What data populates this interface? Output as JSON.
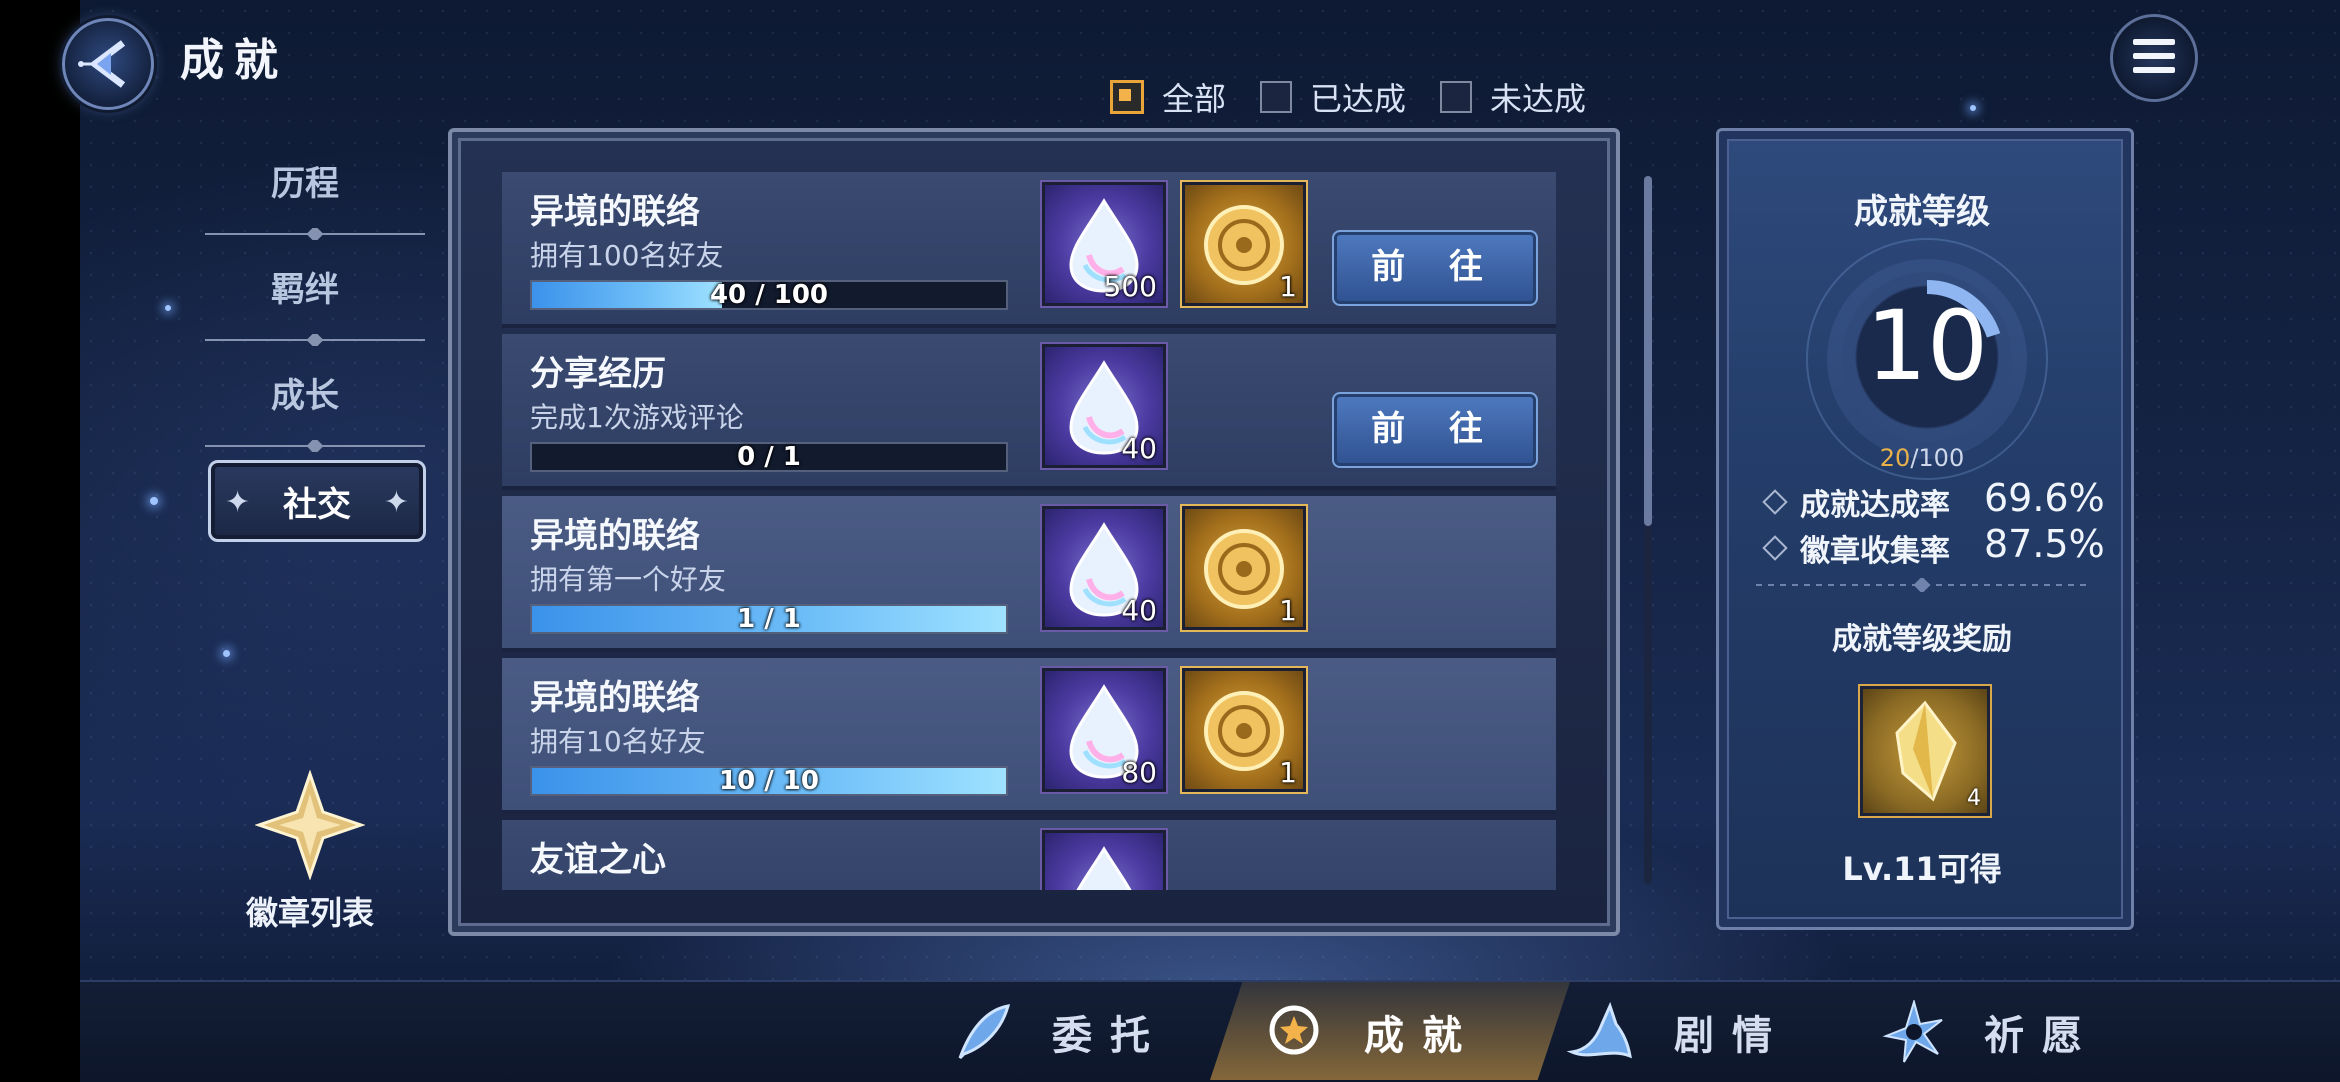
{
  "header": {
    "title": "成就"
  },
  "filters": [
    {
      "label": "全部",
      "checked": true
    },
    {
      "label": "已达成",
      "checked": false
    },
    {
      "label": "未达成",
      "checked": false
    }
  ],
  "sidebar": {
    "items": [
      {
        "label": "历程",
        "active": false
      },
      {
        "label": "羁绊",
        "active": false
      },
      {
        "label": "成长",
        "active": false
      },
      {
        "label": "社交",
        "active": true
      }
    ],
    "badge_list_label": "徽章列表"
  },
  "achievements": [
    {
      "title": "异境的联络",
      "desc": "拥有100名好友",
      "progress_text": "40 / 100",
      "progress": 0.4,
      "rewards": [
        {
          "type": "gem",
          "qty": "500"
        },
        {
          "type": "coin",
          "qty": "1"
        }
      ],
      "button": "前 往",
      "completed": false
    },
    {
      "title": "分享经历",
      "desc": "完成1次游戏评论",
      "progress_text": "0 / 1",
      "progress": 0,
      "rewards": [
        {
          "type": "gem",
          "qty": "40"
        }
      ],
      "button": "前 往",
      "completed": false
    },
    {
      "title": "异境的联络",
      "desc": "拥有第一个好友",
      "progress_text": "1 / 1",
      "progress": 1,
      "rewards": [
        {
          "type": "gem",
          "qty": "40"
        },
        {
          "type": "coin",
          "qty": "1"
        }
      ],
      "completed": true
    },
    {
      "title": "异境的联络",
      "desc": "拥有10名好友",
      "progress_text": "10 / 10",
      "progress": 1,
      "rewards": [
        {
          "type": "gem",
          "qty": "80"
        },
        {
          "type": "coin",
          "qty": "1"
        }
      ],
      "completed": true
    },
    {
      "title": "友谊之心",
      "desc": "",
      "progress_text": "",
      "progress": 0,
      "rewards": [
        {
          "type": "gem",
          "qty": ""
        }
      ],
      "completed": false
    }
  ],
  "level_panel": {
    "title": "成就等级",
    "level": "10",
    "exp_current": "20",
    "exp_max": "/100",
    "stats": [
      {
        "label": "成就达成率",
        "value": "69.6%"
      },
      {
        "label": "徽章收集率",
        "value": "87.5%"
      }
    ],
    "reward_title": "成就等级奖励",
    "reward_qty": "4",
    "reward_condition": "Lv.11可得"
  },
  "bottom_tabs": [
    {
      "label": "委托",
      "icon": "feather-icon",
      "active": false
    },
    {
      "label": "成就",
      "icon": "medal-icon",
      "active": true
    },
    {
      "label": "剧情",
      "icon": "fox-icon",
      "active": false
    },
    {
      "label": "祈愿",
      "icon": "star-burst-icon",
      "active": false
    }
  ],
  "colors": {
    "accent_gold": "#f3b24a",
    "progress_blue": "#6fbff8",
    "button_blue": "#4f7ac0"
  }
}
